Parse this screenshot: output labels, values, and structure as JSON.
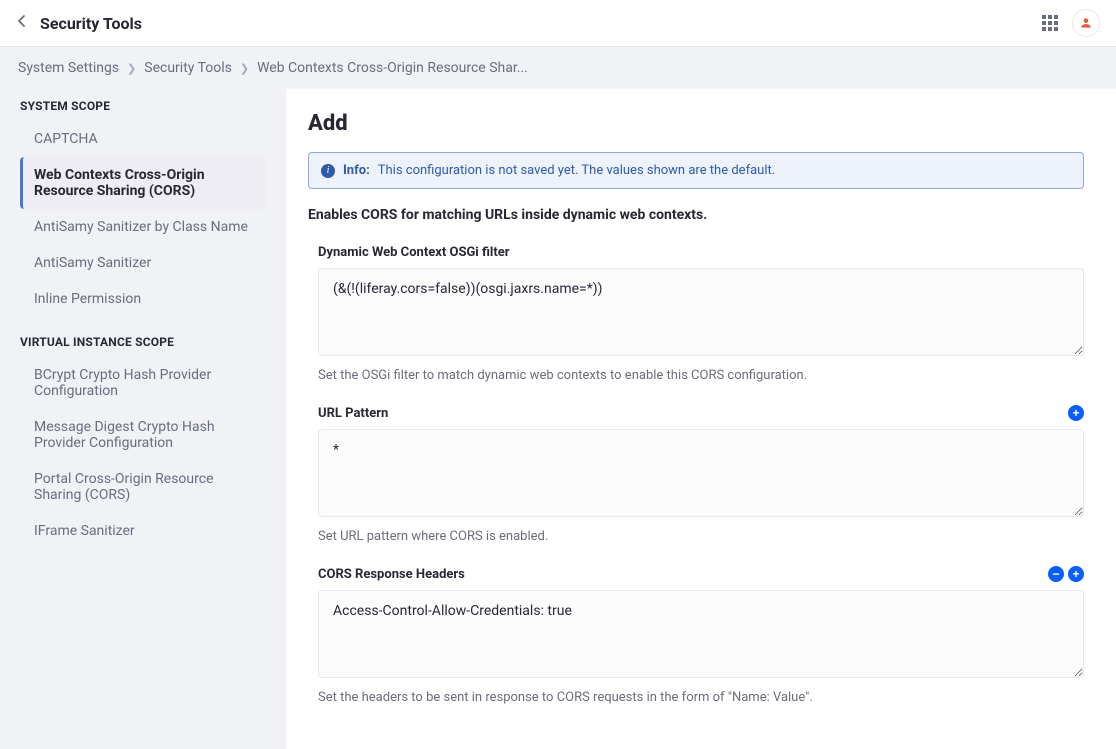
{
  "header": {
    "title": "Security Tools"
  },
  "breadcrumb": {
    "items": [
      "System Settings",
      "Security Tools",
      "Web Contexts Cross-Origin Resource Shar..."
    ]
  },
  "sidebar": {
    "sections": [
      {
        "heading": "SYSTEM SCOPE",
        "items": [
          {
            "label": "CAPTCHA",
            "active": false
          },
          {
            "label": "Web Contexts Cross-Origin Resource Sharing (CORS)",
            "active": true
          },
          {
            "label": "AntiSamy Sanitizer by Class Name",
            "active": false
          },
          {
            "label": "AntiSamy Sanitizer",
            "active": false
          },
          {
            "label": "Inline Permission",
            "active": false
          }
        ]
      },
      {
        "heading": "VIRTUAL INSTANCE SCOPE",
        "items": [
          {
            "label": "BCrypt Crypto Hash Provider Configuration",
            "active": false
          },
          {
            "label": "Message Digest Crypto Hash Provider Configuration",
            "active": false
          },
          {
            "label": "Portal Cross-Origin Resource Sharing (CORS)",
            "active": false
          },
          {
            "label": "IFrame Sanitizer",
            "active": false
          }
        ]
      }
    ]
  },
  "main": {
    "heading": "Add",
    "alert": {
      "label": "Info:",
      "text": "This configuration is not saved yet. The values shown are the default."
    },
    "description": "Enables CORS for matching URLs inside dynamic web contexts.",
    "fields": [
      {
        "label": "Dynamic Web Context OSGi filter",
        "value": "(&(!(liferay.cors=false))(osgi.jaxrs.name=*))",
        "help": "Set the OSGi filter to match dynamic web contexts to enable this CORS configuration.",
        "addable": false,
        "removable": false
      },
      {
        "label": "URL Pattern",
        "value": "*",
        "help": "Set URL pattern where CORS is enabled.",
        "addable": true,
        "removable": false
      },
      {
        "label": "CORS Response Headers",
        "value": "Access-Control-Allow-Credentials: true",
        "help": "Set the headers to be sent in response to CORS requests in the form of \"Name: Value\".",
        "addable": true,
        "removable": true
      }
    ]
  }
}
